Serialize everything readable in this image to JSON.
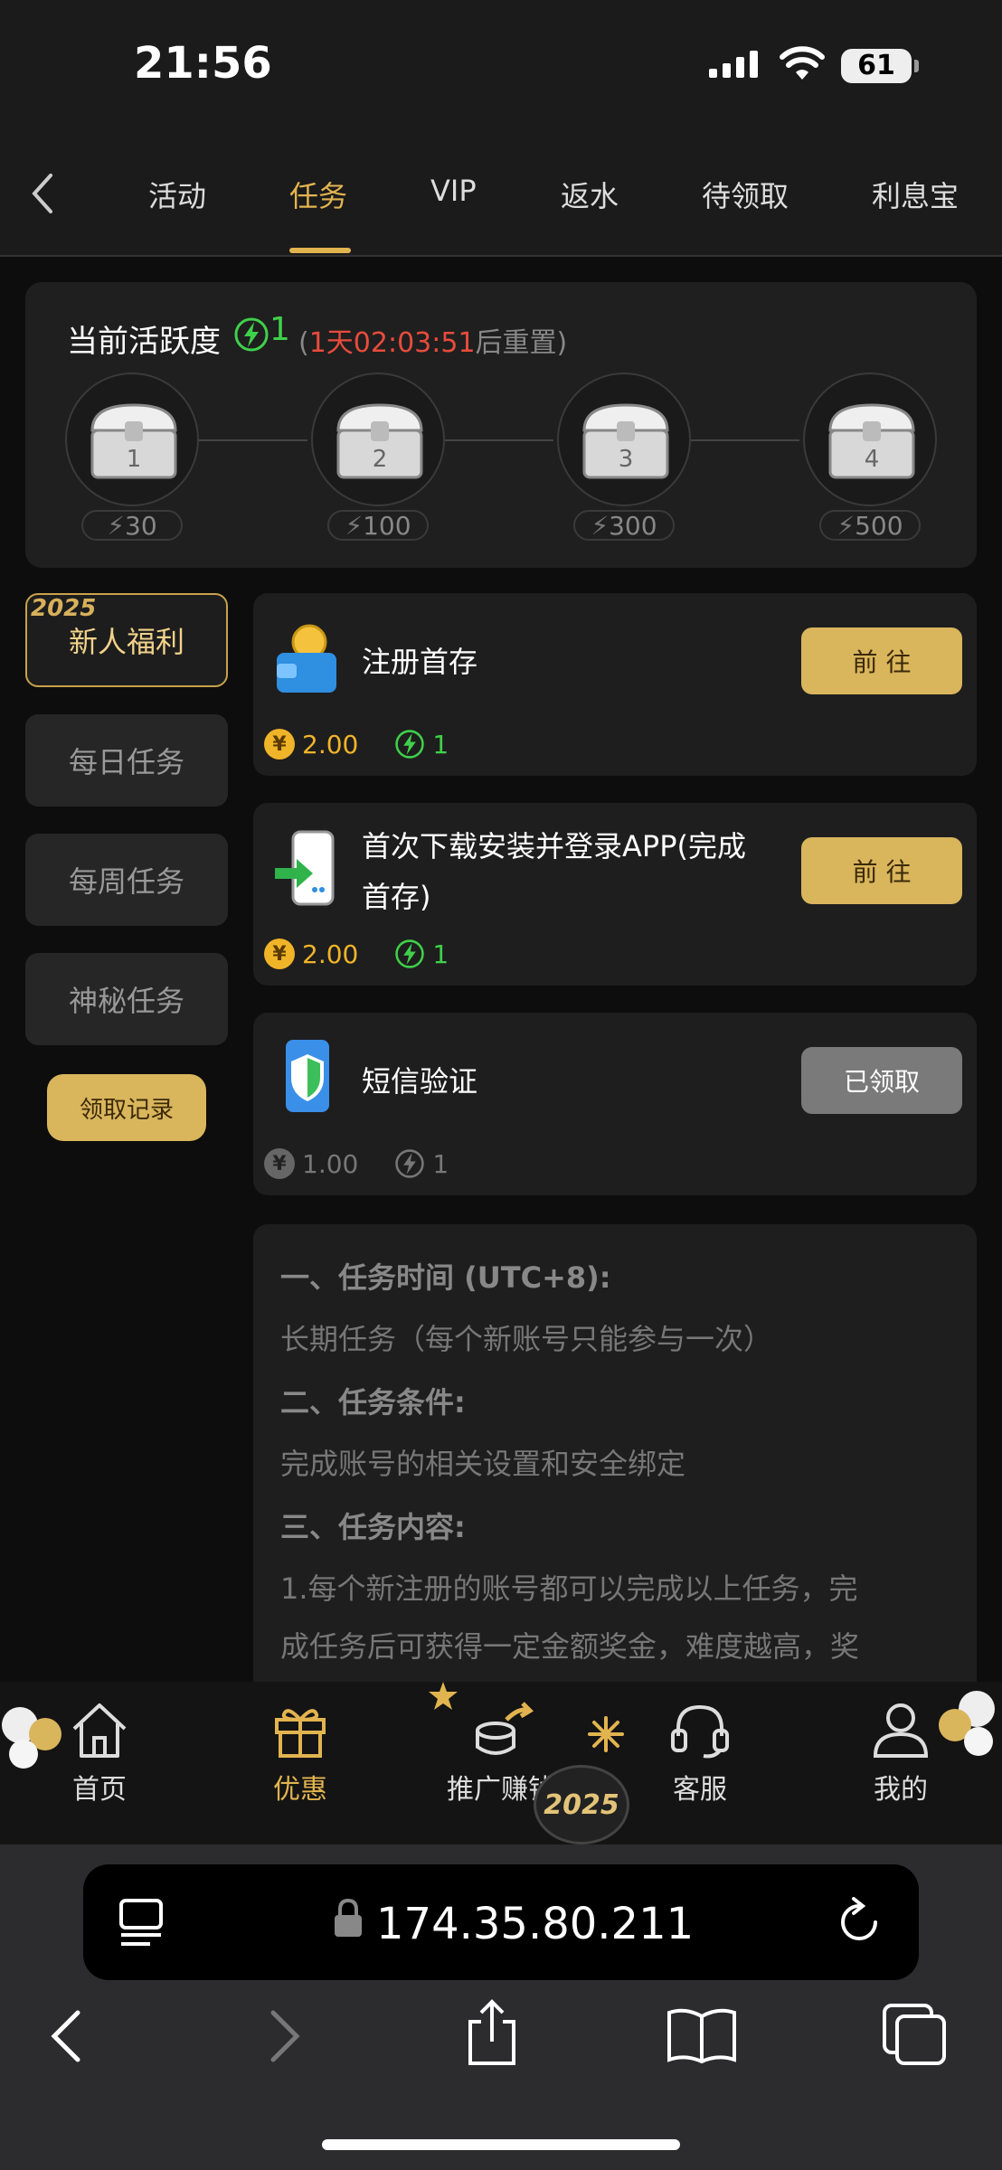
{
  "status_bar": {
    "time": "21:56",
    "battery": "61"
  },
  "tabs": [
    {
      "label": "活动",
      "active": false
    },
    {
      "label": "任务",
      "active": true
    },
    {
      "label": "VIP",
      "active": false
    },
    {
      "label": "返水",
      "active": false
    },
    {
      "label": "待领取",
      "active": false
    },
    {
      "label": "利息宝",
      "active": false
    }
  ],
  "activity": {
    "title": "当前活跃度",
    "score": "1",
    "timer_open": "(",
    "timer_value": "1天02:03:51",
    "timer_suffix": "后重置)",
    "chests": [
      {
        "number": "1",
        "points": "30"
      },
      {
        "number": "2",
        "points": "100"
      },
      {
        "number": "3",
        "points": "300"
      },
      {
        "number": "4",
        "points": "500"
      }
    ]
  },
  "sidebar": {
    "badge": "2025",
    "items": [
      "新人福利",
      "每日任务",
      "每周任务",
      "神秘任务"
    ],
    "record_button": "领取记录"
  },
  "tasks": [
    {
      "title": "注册首存",
      "title_line2": "",
      "button": "前 往",
      "coin": "2.00",
      "points": "1",
      "done": false
    },
    {
      "title": "首次下载安装并登录APP(完成",
      "title_line2": "首存)",
      "button": "前 往",
      "coin": "2.00",
      "points": "1",
      "done": false
    },
    {
      "title": "短信验证",
      "title_line2": "",
      "button": "已领取",
      "coin": "1.00",
      "points": "1",
      "done": true
    }
  ],
  "coin_symbol": "¥",
  "info": {
    "h1": "一、任务时间 (UTC+8):",
    "p1": "长期任务（每个新账号只能参与一次）",
    "h2": "二、任务条件:",
    "p2": "完成账号的相关设置和安全绑定",
    "h3": "三、任务内容:",
    "p3a": "1.每个新注册的账号都可以完成以上任务，完",
    "p3b": "成任务后可获得一定金额奖金，难度越高，奖"
  },
  "bottom_nav": [
    {
      "label": "首页",
      "icon": "home-icon",
      "active": false
    },
    {
      "label": "优惠",
      "icon": "gift-icon",
      "active": true
    },
    {
      "label": "推广赚钱",
      "icon": "coins-icon",
      "active": false
    },
    {
      "label": "客服",
      "icon": "headset-icon",
      "active": false
    },
    {
      "label": "我的",
      "icon": "user-icon",
      "active": false
    }
  ],
  "nav_badge": "2025",
  "browser": {
    "url": "174.35.80.211"
  },
  "colors": {
    "accent": "#e2b44f",
    "green": "#3fd04a",
    "red": "#e94b3c"
  }
}
